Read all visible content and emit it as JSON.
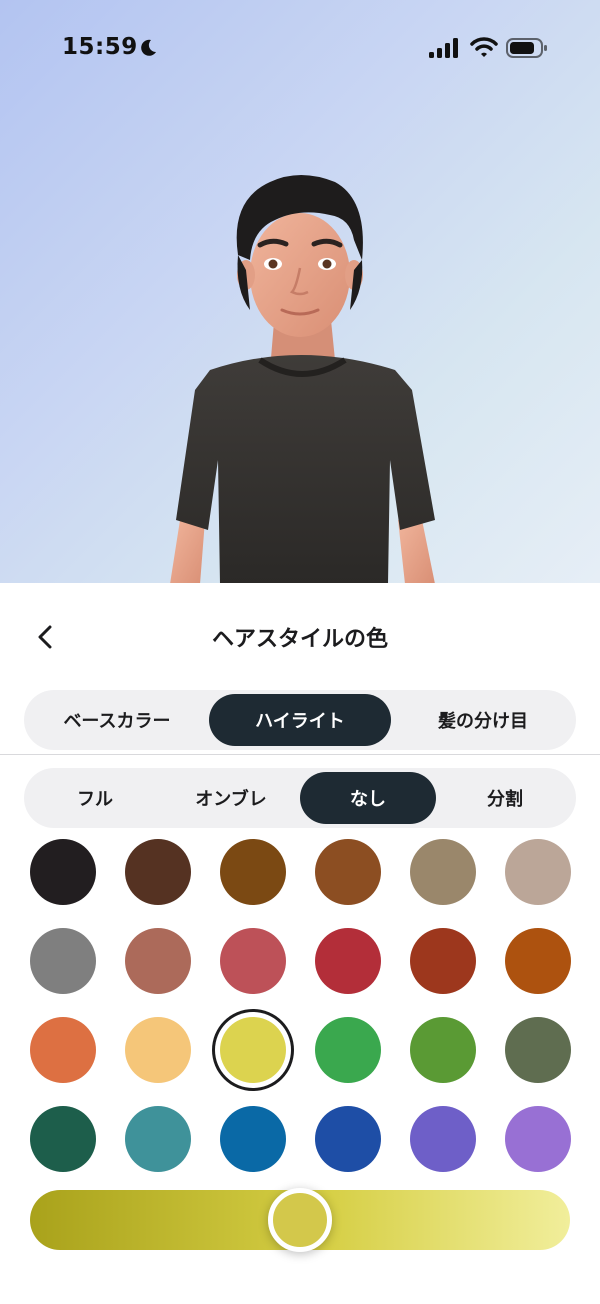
{
  "status_bar": {
    "time": "15:59",
    "icons": [
      "moon-icon",
      "signal-icon",
      "wifi-icon",
      "battery-icon"
    ]
  },
  "header": {
    "back_icon": "chevron-left-icon",
    "title": "ヘアスタイルの色"
  },
  "color_type_tabs": [
    {
      "label": "ベースカラー",
      "active": false
    },
    {
      "label": "ハイライト",
      "active": true
    },
    {
      "label": "髪の分け目",
      "active": false
    }
  ],
  "highlight_style_tabs": [
    {
      "label": "フル",
      "active": false
    },
    {
      "label": "オンブレ",
      "active": false
    },
    {
      "label": "なし",
      "active": true
    },
    {
      "label": "分割",
      "active": false
    }
  ],
  "swatches": [
    {
      "color": "#221e20"
    },
    {
      "color": "#553222"
    },
    {
      "color": "#7b4913"
    },
    {
      "color": "#8c4e22"
    },
    {
      "color": "#9a876b"
    },
    {
      "color": "#bba698"
    },
    {
      "color": "#7f7f7f"
    },
    {
      "color": "#ac6a5a"
    },
    {
      "color": "#bd5158"
    },
    {
      "color": "#b32e39"
    },
    {
      "color": "#9d371d"
    },
    {
      "color": "#ad520f"
    },
    {
      "color": "#dd7042"
    },
    {
      "color": "#f5c679"
    },
    {
      "color": "#dcd34f",
      "selected": true
    },
    {
      "color": "#3aa84e"
    },
    {
      "color": "#5a9a34"
    },
    {
      "color": "#5f6d50"
    },
    {
      "color": "#1d5e4b"
    },
    {
      "color": "#3f929a"
    },
    {
      "color": "#0a69a6"
    },
    {
      "color": "#1e4ea6"
    },
    {
      "color": "#6e5fc8"
    },
    {
      "color": "#9870d4"
    }
  ],
  "shade_slider": {
    "gradient_from": "#a9a21b",
    "gradient_mid": "#d6cf45",
    "gradient_to": "#f1ee9b",
    "thumb_color": "#d3c84b",
    "value_fraction": 0.5
  }
}
